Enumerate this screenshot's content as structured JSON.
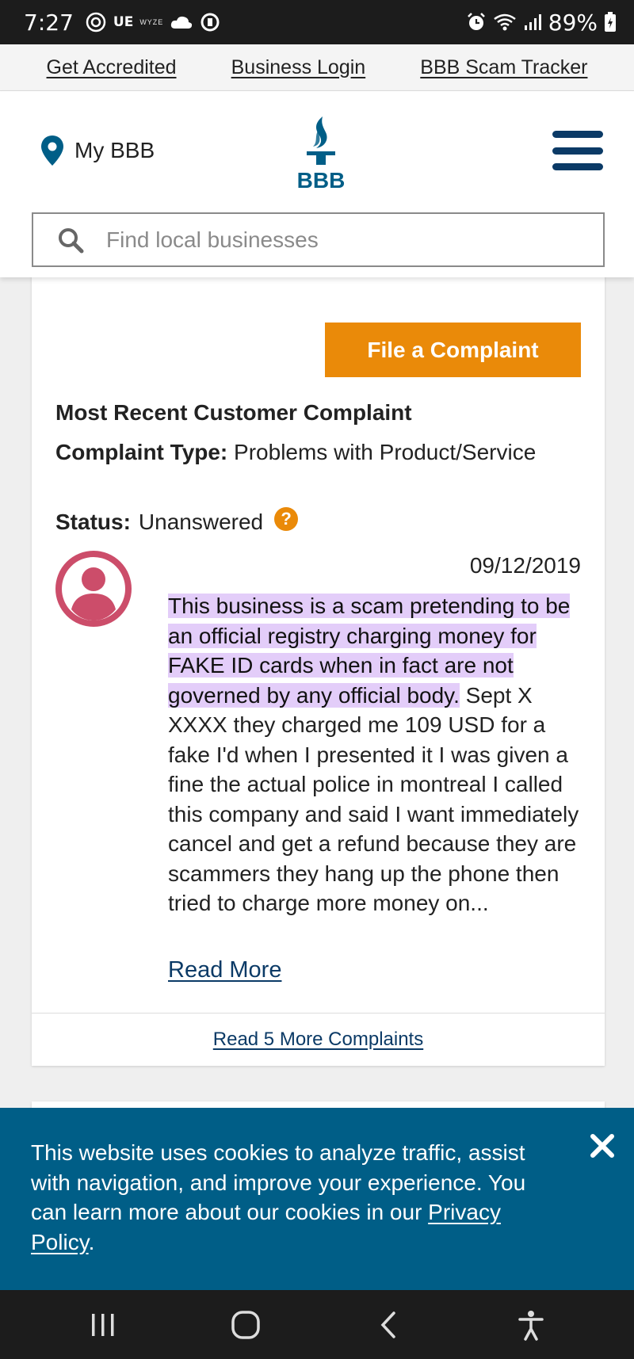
{
  "status_bar": {
    "time": "7:27",
    "carrier": "UE",
    "wyze": "WYZE",
    "battery": "89%"
  },
  "utility_nav": {
    "items": [
      "Get Accredited",
      "Business Login",
      "BBB Scam Tracker"
    ]
  },
  "header": {
    "my_bbb": "My BBB",
    "logo_text": "BBB",
    "search_placeholder": "Find local businesses"
  },
  "complaint": {
    "file_button": "File a Complaint",
    "heading": "Most Recent Customer Complaint",
    "type_label": "Complaint Type:",
    "type_value": "Problems with Product/Service",
    "status_label": "Status:",
    "status_value": "Unanswered",
    "help_symbol": "?",
    "date": "09/12/2019",
    "text_highlighted": "This business is a scam pretending to be an official registry charging money for FAKE ID cards when in fact are not governed by any official body.",
    "text_rest": " Sept X XXXX they charged me 109 USD for a fake I'd when I presented it I was given a fine the actual police in montreal I called this company and said I want immediately cancel and get a refund because they are scammers they hang up the phone then tried to charge more money on...",
    "read_more": "Read More",
    "read_more_complaints": "Read 5 More Complaints"
  },
  "cookie_banner": {
    "text": "This website uses cookies to analyze traffic, assist with navigation, and improve your experience. You can learn more about our cookies in our ",
    "link": "Privacy Policy",
    "suffix": "."
  },
  "colors": {
    "accent_orange": "#ea8a09",
    "bbb_blue": "#005e87",
    "navy": "#0b3a66",
    "highlight": "#e3cdf9",
    "avatar": "#cc4d6a"
  }
}
